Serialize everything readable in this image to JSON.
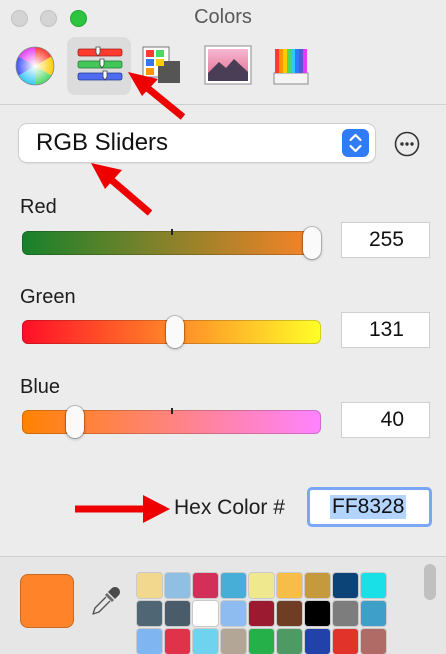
{
  "window": {
    "title": "Colors"
  },
  "toolbar": {
    "tools": [
      {
        "name": "Color Wheel",
        "active": false
      },
      {
        "name": "Color Sliders",
        "active": true
      },
      {
        "name": "Color Palettes",
        "active": false
      },
      {
        "name": "Image Palettes",
        "active": false
      },
      {
        "name": "Pencils",
        "active": false
      }
    ]
  },
  "mode_popup": {
    "selected": "RGB Sliders"
  },
  "sliders": [
    {
      "label": "Red",
      "value": "255",
      "level": 1.0,
      "gradient": [
        "#17812b",
        "#ff8328"
      ]
    },
    {
      "label": "Green",
      "value": "131",
      "level": 0.514,
      "gradient": [
        "#ff0e28",
        "#ffff28"
      ]
    },
    {
      "label": "Blue",
      "value": "40",
      "level": 0.157,
      "gradient": [
        "#ff8300",
        "#ff83ff"
      ]
    }
  ],
  "hex": {
    "label": "Hex Color #",
    "value": "FF8328"
  },
  "current_color": "#ff8328",
  "swatches": [
    [
      "#f2d88e",
      "#8fbfe3",
      "#d22f59",
      "#46aed7",
      "#f0e88f",
      "#f6bd47",
      "#c59a3f",
      "#0d4478",
      "#19dfe7"
    ],
    [
      "#4f6675",
      "#4a5b69",
      "#ffffff",
      "#8ebbf0",
      "#9c1a30",
      "#6e3d24",
      "#000000",
      "#7d7d7d",
      "#3ea0c8"
    ],
    [
      "#7fb6f2",
      "#e0334a",
      "#6fd3f0",
      "#b3a696",
      "#26b04a",
      "#4f9a64",
      "#2142a8",
      "#e1332a",
      "#b06b66"
    ]
  ]
}
